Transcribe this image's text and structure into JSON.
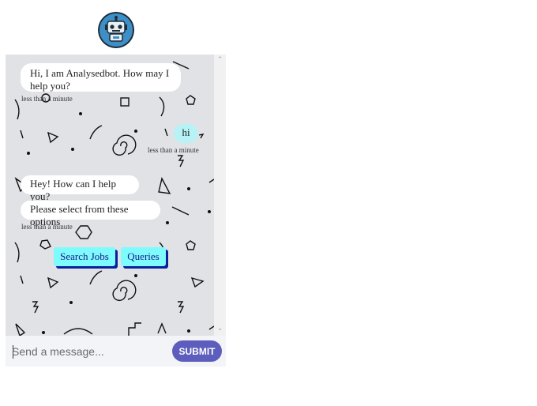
{
  "header": {
    "avatar_icon": "robot-icon"
  },
  "messages": [
    {
      "from": "bot",
      "text": "Hi, I am Analysedbot. How may I help you?"
    },
    {
      "from": "bot_time",
      "text": "less than a minute"
    },
    {
      "from": "user",
      "text": "hi"
    },
    {
      "from": "user_time",
      "text": "less than a minute"
    },
    {
      "from": "bot",
      "text": "Hey! How can I help you?"
    },
    {
      "from": "bot",
      "text": "Please select from these options"
    },
    {
      "from": "bot_time",
      "text": "less than a minute"
    }
  ],
  "options": [
    "Search Jobs",
    "Queries"
  ],
  "composer": {
    "placeholder": "Send a message...",
    "submit_label": "SUBMIT"
  },
  "colors": {
    "bot_bubble": "#ffffff",
    "user_bubble": "#b7f2f6",
    "option_button": "#7efbfd",
    "option_shadow": "#0b1f9a",
    "submit": "#5c5dbd",
    "chat_background": "#e1e2e6",
    "avatar": "#3d8fc6"
  }
}
